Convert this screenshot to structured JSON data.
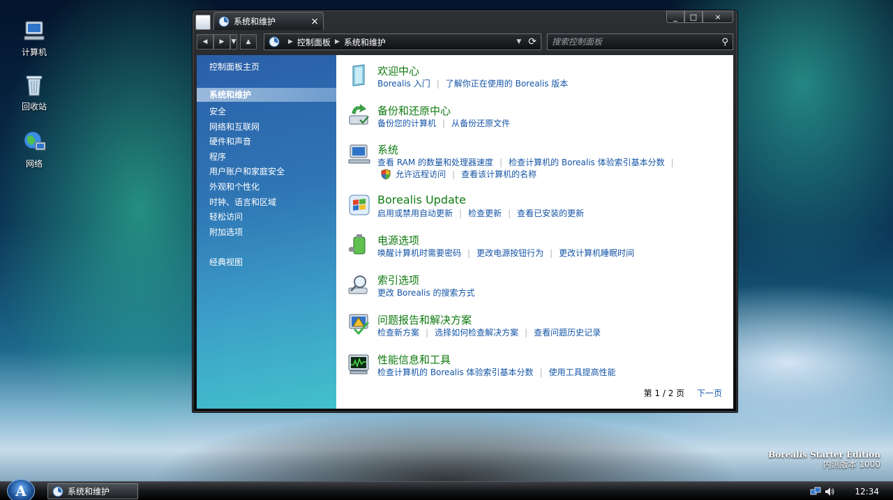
{
  "desktop": {
    "icons": [
      {
        "label": "计算机"
      },
      {
        "label": "回收站"
      },
      {
        "label": "网络"
      }
    ],
    "watermark": {
      "edition": "Borealis Starter Edition",
      "build": "内测版本 1000"
    }
  },
  "window": {
    "tab_label": "系统和维护",
    "close_glyph": "×",
    "controls": {
      "min": "_",
      "max": "□",
      "close": "×"
    }
  },
  "navbar": {
    "back": "◀",
    "forward": "▶",
    "recent": "▼",
    "up": "▲",
    "breadcrumbs": [
      "控制面板",
      "系统和维护"
    ],
    "refresh": "⟳",
    "search_placeholder": "搜索控制面板"
  },
  "sidebar": {
    "home": "控制面板主页",
    "items": [
      {
        "label": "系统和维护",
        "active": true
      },
      {
        "label": "安全"
      },
      {
        "label": "网络和互联网"
      },
      {
        "label": "硬件和声音"
      },
      {
        "label": "程序"
      },
      {
        "label": "用户账户和家庭安全"
      },
      {
        "label": "外观和个性化"
      },
      {
        "label": "时钟、语言和区域"
      },
      {
        "label": "轻松访问"
      },
      {
        "label": "附加选项"
      }
    ],
    "classic": "经典视图"
  },
  "categories": [
    {
      "title": "欢迎中心",
      "icon": "welcome-center-icon",
      "links": [
        "Borealis 入门",
        "了解你正在使用的 Borealis 版本"
      ]
    },
    {
      "title": "备份和还原中心",
      "icon": "backup-icon",
      "links": [
        "备份您的计算机",
        "从备份还原文件"
      ]
    },
    {
      "title": "系统",
      "icon": "system-icon",
      "links": [
        "查看 RAM 的数量和处理器速度",
        "检查计算机的 Borealis 体验索引基本分数"
      ],
      "links2": [
        "允许远程访问",
        "查看该计算机的名称"
      ]
    },
    {
      "title": "Borealis Update",
      "icon": "update-icon",
      "links": [
        "启用或禁用自动更新",
        "检查更新",
        "查看已安装的更新"
      ]
    },
    {
      "title": "电源选项",
      "icon": "power-icon",
      "links": [
        "唤醒计算机时需要密码",
        "更改电源按钮行为",
        "更改计算机睡眠时间"
      ]
    },
    {
      "title": "索引选项",
      "icon": "indexing-icon",
      "links": [
        "更改 Borealis 的搜索方式"
      ]
    },
    {
      "title": "问题报告和解决方案",
      "icon": "problem-reports-icon",
      "links": [
        "检查新方案",
        "选择如何检查解决方案",
        "查看问题历史记录"
      ]
    },
    {
      "title": "性能信息和工具",
      "icon": "performance-icon",
      "links": [
        "检查计算机的 Borealis 体验索引基本分数",
        "使用工具提高性能"
      ]
    }
  ],
  "pager": {
    "info": "第 1 / 2 页",
    "next": "下一页"
  },
  "taskbar": {
    "start_glyph": "A",
    "task_label": "系统和维护",
    "clock": "12:34"
  }
}
